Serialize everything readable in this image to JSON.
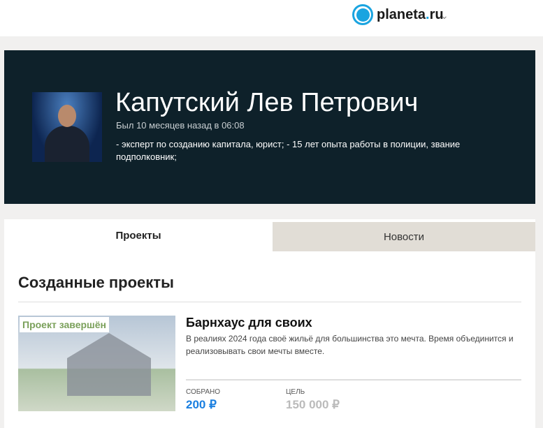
{
  "header": {
    "logo_main": "planeta",
    "logo_dot": ".",
    "logo_tld": "ru",
    "menu_chevron": "chevron-down-icon"
  },
  "profile": {
    "name": "Капутский Лев Петрович",
    "last_seen": "Был 10 месяцев назад в 06:08",
    "bio": "- эксперт по созданию капитала, юрист; - 15 лет опыта работы в полиции, звание подполковник;"
  },
  "tabs": [
    {
      "label": "Проекты",
      "active": true
    },
    {
      "label": "Новости",
      "active": false
    }
  ],
  "section_title": "Созданные проекты",
  "projects": [
    {
      "status": "Проект завершён",
      "title": "Барнхаус для своих",
      "description": "В реалиях 2024 года своё жильё для большинства это мечта. Время объединится и реализовывать свои мечты вместе.",
      "collected_label": "СОБРАНО",
      "collected": "200 ₽",
      "goal_label": "ЦЕЛЬ",
      "goal": "150 000 ₽"
    }
  ],
  "colors": {
    "accent": "#1aa4e0",
    "hero_bg": "#0e212a",
    "collected": "#1a7fe0",
    "status": "#7aa05a"
  }
}
